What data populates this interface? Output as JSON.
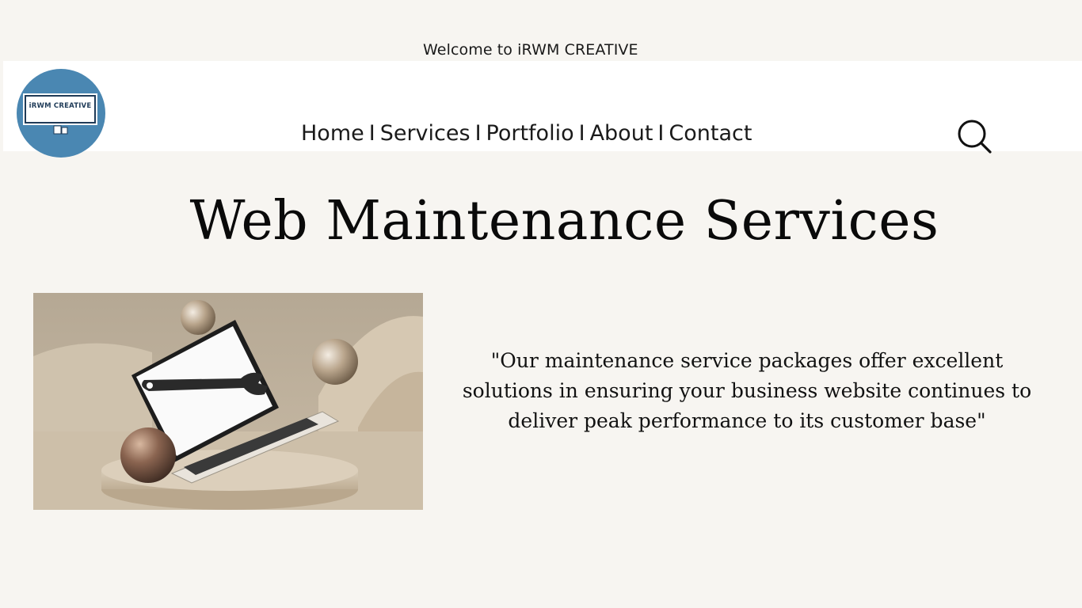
{
  "header": {
    "welcome_text": "Welcome to iRWM CREATIVE",
    "logo_text": "iRWM CREATIVE",
    "nav": {
      "items": [
        {
          "label": "Home"
        },
        {
          "label": "Services"
        },
        {
          "label": "Portfolio"
        },
        {
          "label": "About"
        },
        {
          "label": "Contact"
        }
      ],
      "separator": "I"
    },
    "search_icon": "search-icon"
  },
  "main": {
    "title": "Web Maintenance Services",
    "quote": "\"Our maintenance service packages offer excellent solutions in ensuring your business website continues to deliver peak performance to its customer base\"",
    "image_icon": "laptop-wrench-illustration"
  },
  "colors": {
    "background": "#f7f5f1",
    "header_bar": "#ffffff",
    "logo_circle": "#4a87b2",
    "logo_ink": "#1f3b58",
    "text": "#111111"
  }
}
